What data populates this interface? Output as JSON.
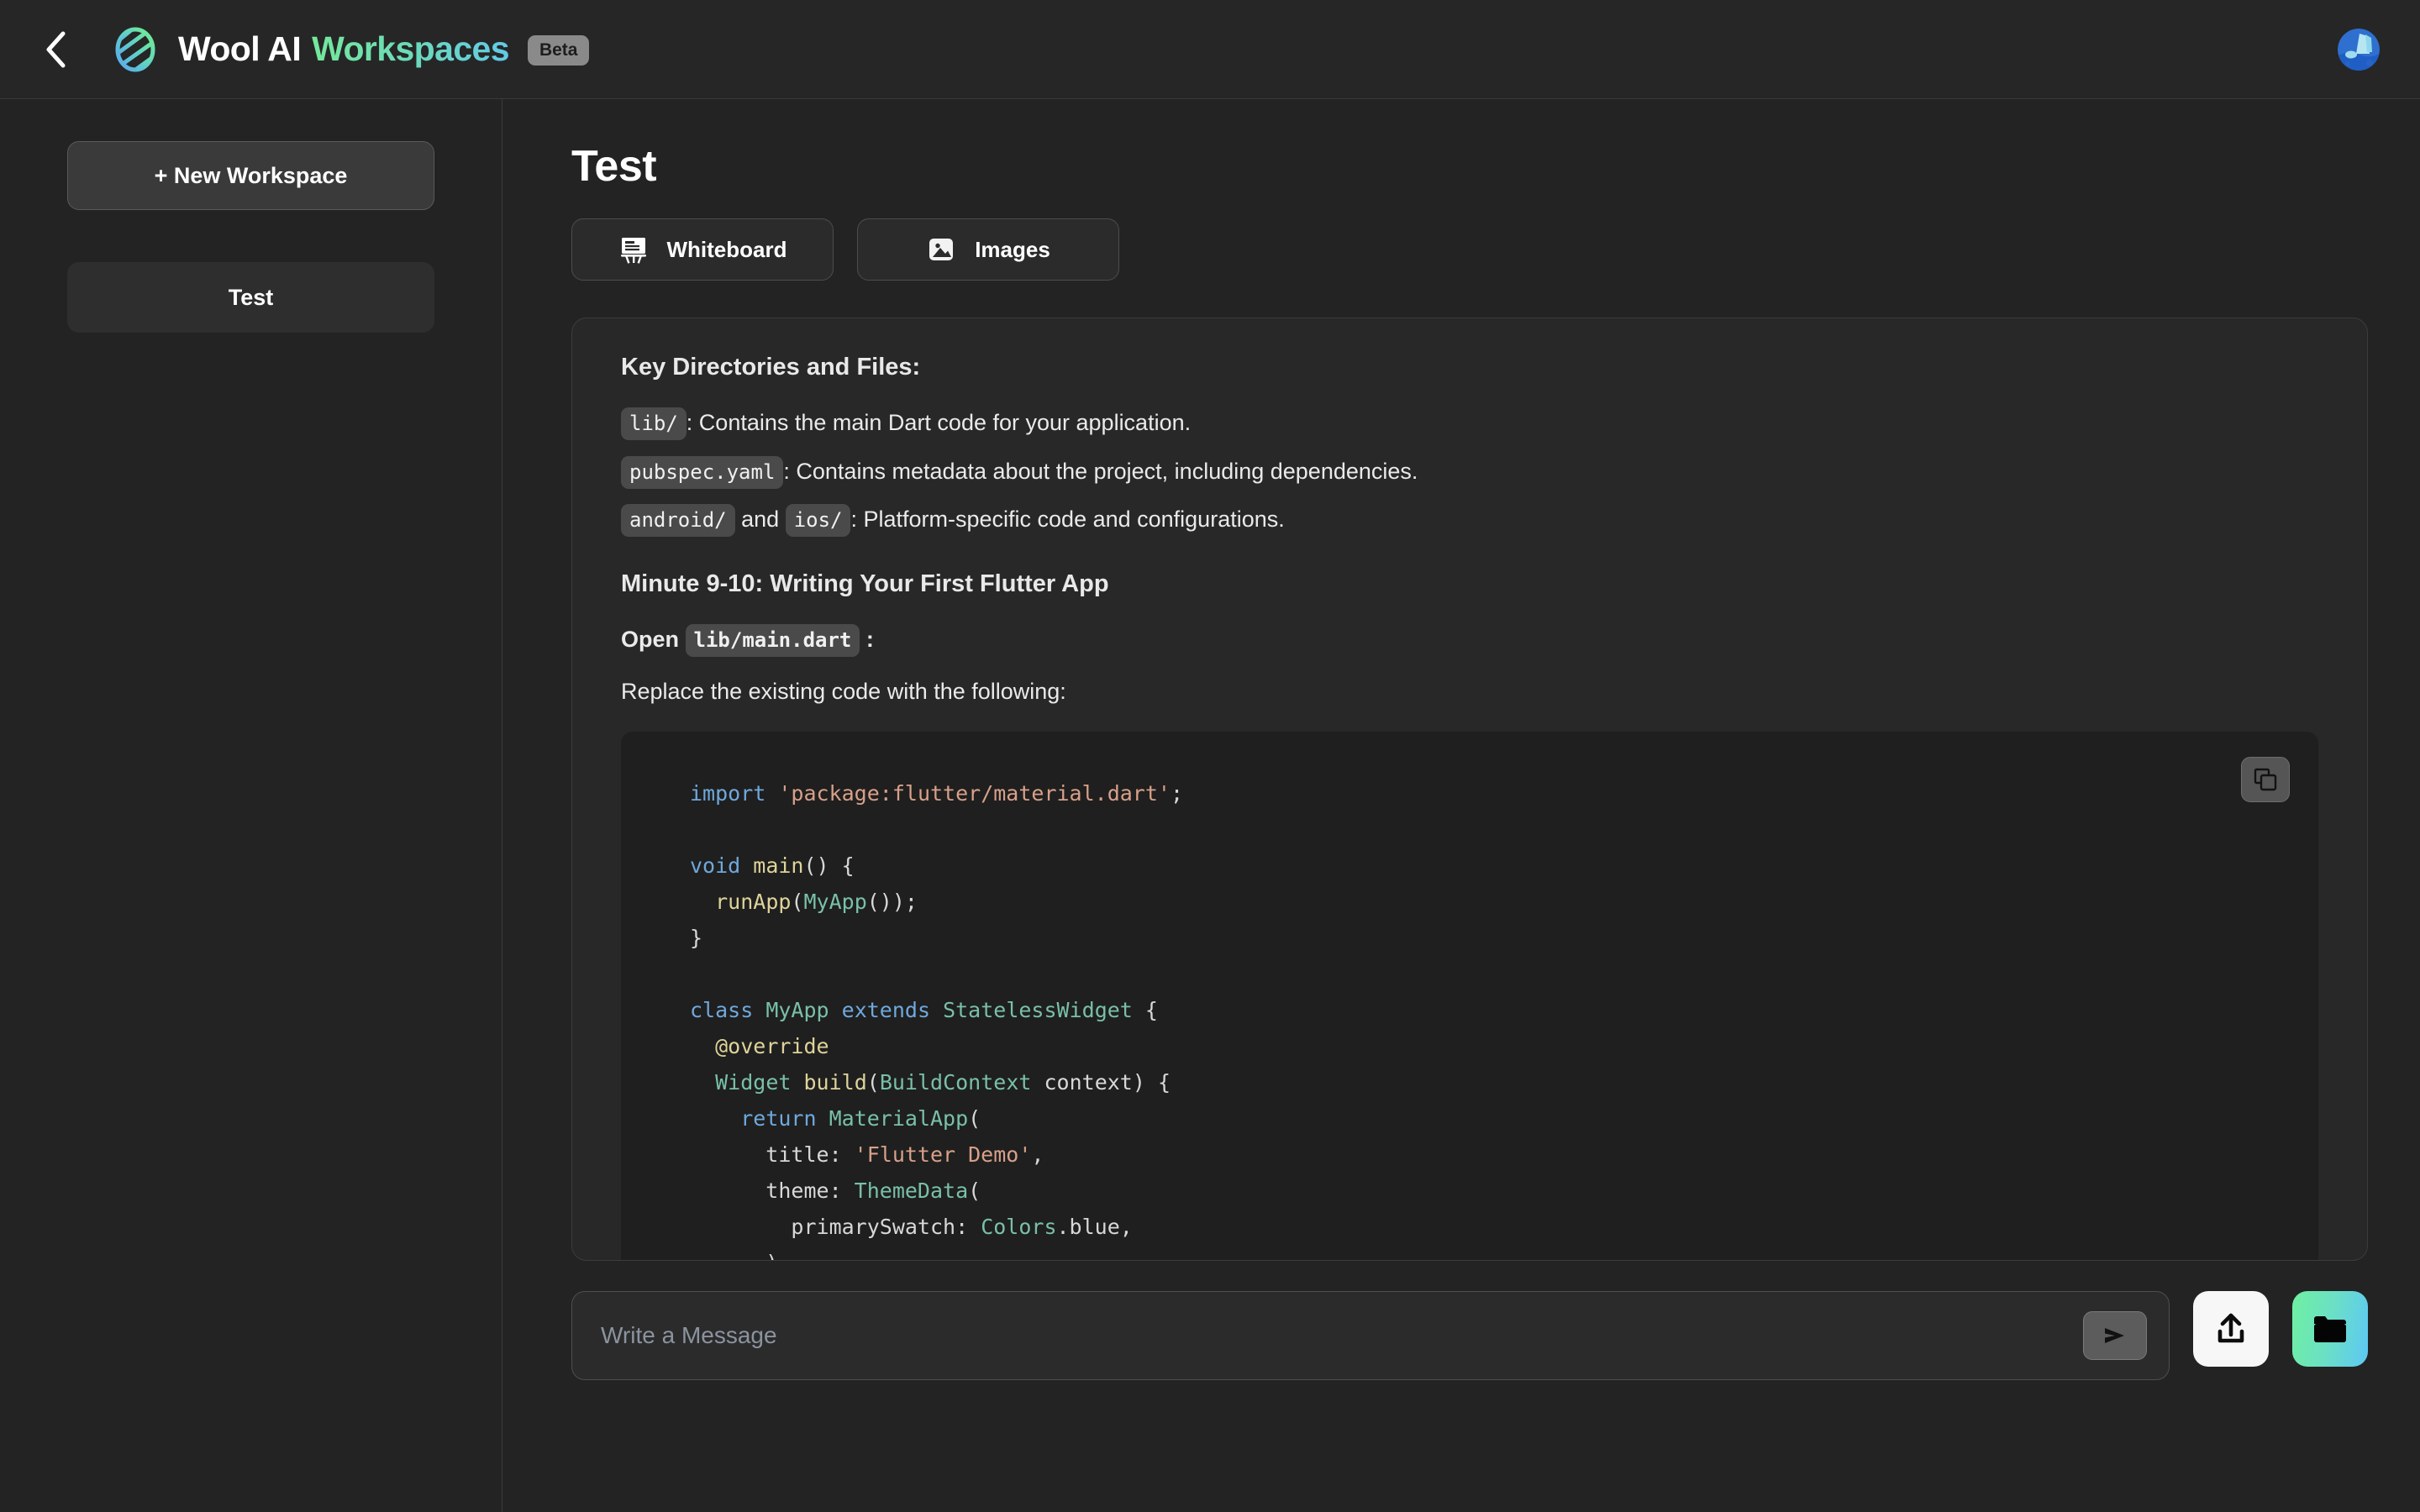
{
  "header": {
    "back_icon": "chevron-left-icon",
    "logo_icon": "wool-logo-icon",
    "brand_primary": "Wool AI",
    "brand_accent": "Workspaces",
    "beta_label": "Beta",
    "avatar_icon": "user-avatar",
    "accent_gradient_start": "#74e89c",
    "accent_gradient_end": "#62c9e8"
  },
  "sidebar": {
    "new_workspace_label": "+ New Workspace",
    "workspaces": [
      {
        "label": "Test"
      }
    ]
  },
  "main": {
    "title": "Test",
    "tabs": [
      {
        "label": "Whiteboard",
        "icon": "whiteboard-easel-icon"
      },
      {
        "label": "Images",
        "icon": "image-picture-icon"
      }
    ]
  },
  "document": {
    "heading_1": "Key Directories and Files:",
    "bullets": [
      {
        "code": "lib/",
        "text": ": Contains the main Dart code for your application."
      },
      {
        "code": "pubspec.yaml",
        "text": ": Contains metadata about the project, including dependencies."
      }
    ],
    "platform_line": {
      "code_a": "android/",
      "joiner": "and",
      "code_b": "ios/",
      "text": ": Platform-specific code and configurations."
    },
    "heading_2": "Minute 9-10: Writing Your First Flutter App",
    "open_line": {
      "prefix": "Open",
      "code": "lib/main.dart",
      "suffix": ":"
    },
    "replace_line": "Replace the existing code with the following:"
  },
  "code_block": {
    "copy_icon": "copy-icon",
    "language": "dart",
    "lines": [
      [
        {
          "t": "import",
          "c": "k"
        },
        {
          "t": " ",
          "c": "pn"
        },
        {
          "t": "'package:flutter/material.dart'",
          "c": "s"
        },
        {
          "t": ";",
          "c": "pn"
        }
      ],
      [],
      [
        {
          "t": "void",
          "c": "k"
        },
        {
          "t": " ",
          "c": "pn"
        },
        {
          "t": "main",
          "c": "fn"
        },
        {
          "t": "() {",
          "c": "pn"
        }
      ],
      [
        {
          "t": "  ",
          "c": "pn"
        },
        {
          "t": "runApp",
          "c": "fn"
        },
        {
          "t": "(",
          "c": "pn"
        },
        {
          "t": "MyApp",
          "c": "ty"
        },
        {
          "t": "());",
          "c": "pn"
        }
      ],
      [
        {
          "t": "}",
          "c": "pn"
        }
      ],
      [],
      [
        {
          "t": "class",
          "c": "k"
        },
        {
          "t": " ",
          "c": "pn"
        },
        {
          "t": "MyApp",
          "c": "ty"
        },
        {
          "t": " ",
          "c": "pn"
        },
        {
          "t": "extends",
          "c": "k"
        },
        {
          "t": " ",
          "c": "pn"
        },
        {
          "t": "StatelessWidget",
          "c": "ty"
        },
        {
          "t": " {",
          "c": "pn"
        }
      ],
      [
        {
          "t": "  ",
          "c": "pn"
        },
        {
          "t": "@override",
          "c": "fn"
        }
      ],
      [
        {
          "t": "  ",
          "c": "pn"
        },
        {
          "t": "Widget",
          "c": "ty"
        },
        {
          "t": " ",
          "c": "pn"
        },
        {
          "t": "build",
          "c": "fn"
        },
        {
          "t": "(",
          "c": "pn"
        },
        {
          "t": "BuildContext",
          "c": "ty"
        },
        {
          "t": " context) {",
          "c": "pn"
        }
      ],
      [
        {
          "t": "    ",
          "c": "pn"
        },
        {
          "t": "return",
          "c": "k"
        },
        {
          "t": " ",
          "c": "pn"
        },
        {
          "t": "MaterialApp",
          "c": "ty"
        },
        {
          "t": "(",
          "c": "pn"
        }
      ],
      [
        {
          "t": "      title: ",
          "c": "pn"
        },
        {
          "t": "'Flutter Demo'",
          "c": "s"
        },
        {
          "t": ",",
          "c": "pn"
        }
      ],
      [
        {
          "t": "      theme: ",
          "c": "pn"
        },
        {
          "t": "ThemeData",
          "c": "ty"
        },
        {
          "t": "(",
          "c": "pn"
        }
      ],
      [
        {
          "t": "        primarySwatch: ",
          "c": "pn"
        },
        {
          "t": "Colors",
          "c": "ty"
        },
        {
          "t": ".blue,",
          "c": "pn"
        }
      ],
      [
        {
          "t": "      ),",
          "c": "pn"
        }
      ]
    ]
  },
  "composer": {
    "placeholder": "Write a Message",
    "value": "",
    "send_icon": "send-arrow-icon",
    "upload_icon": "upload-icon",
    "folder_icon": "folder-icon",
    "folder_gradient_start": "#6ef0a0",
    "folder_gradient_end": "#5cc8f5"
  }
}
